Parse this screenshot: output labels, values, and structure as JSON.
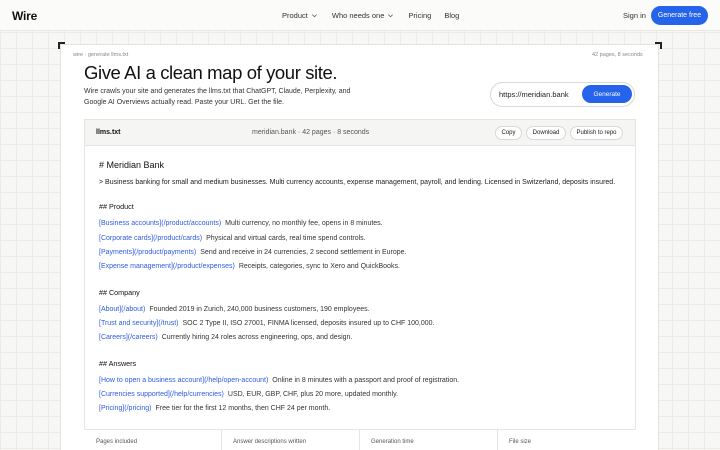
{
  "nav": {
    "logo": "Wire",
    "links": [
      "Product",
      "Who needs one",
      "Pricing",
      "Blog"
    ],
    "sign_in": "Sign in",
    "cta": "Generate free"
  },
  "hero": {
    "breadcrumb": "wire · generate llms.txt",
    "meta": "42 pages, 8 seconds",
    "headline": "Give AI a clean map of your site.",
    "subtext": "Wire crawls your site and generates the llms.txt that ChatGPT, Claude, Perplexity, and Google AI Overviews actually read. Paste your URL. Get the file.",
    "url_value": "https://meridian.bank",
    "generate_label": "Generate"
  },
  "panel": {
    "filename": "llms.txt",
    "info": "meridian.bank · 42 pages · 8 seconds",
    "buttons": [
      "Copy",
      "Download",
      "Publish to repo"
    ]
  },
  "doc": {
    "title": "# Meridian Bank",
    "summary": "> Business banking for small and medium businesses. Multi currency accounts, expense management, payroll, and lending. Licensed in Switzerland, deposits insured.",
    "sections": [
      {
        "heading": "## Product",
        "items": [
          {
            "link": "[Business accounts](/product/accounts)",
            "desc": "Multi currency, no monthly fee, opens in 8 minutes."
          },
          {
            "link": "[Corporate cards](/product/cards)",
            "desc": "Physical and virtual cards, real time spend controls."
          },
          {
            "link": "[Payments](/product/payments)",
            "desc": "Send and receive in 24 currencies, 2 second settlement in Europe."
          },
          {
            "link": "[Expense management](/product/expenses)",
            "desc": "Receipts, categories, sync to Xero and QuickBooks."
          }
        ]
      },
      {
        "heading": "## Company",
        "items": [
          {
            "link": "[About](/about)",
            "desc": "Founded 2019 in Zurich, 240,000 business customers, 190 employees."
          },
          {
            "link": "[Trust and security](/trust)",
            "desc": "SOC 2 Type II, ISO 27001, FINMA licensed, deposits insured up to CHF 100,000."
          },
          {
            "link": "[Careers](/careers)",
            "desc": "Currently hiring 24 roles across engineering, ops, and design."
          }
        ]
      },
      {
        "heading": "## Answers",
        "items": [
          {
            "link": "[How to open a business account](/help/open-account)",
            "desc": "Online in 8 minutes with a passport and proof of registration."
          },
          {
            "link": "[Currencies supported](/help/currencies)",
            "desc": "USD, EUR, GBP, CHF, plus 20 more, updated monthly."
          },
          {
            "link": "[Pricing](/pricing)",
            "desc": "Free tier for the first 12 months, then CHF 24 per month."
          }
        ]
      }
    ]
  },
  "stats": [
    "Pages included",
    "Answer descriptions written",
    "Generation time",
    "File size"
  ]
}
